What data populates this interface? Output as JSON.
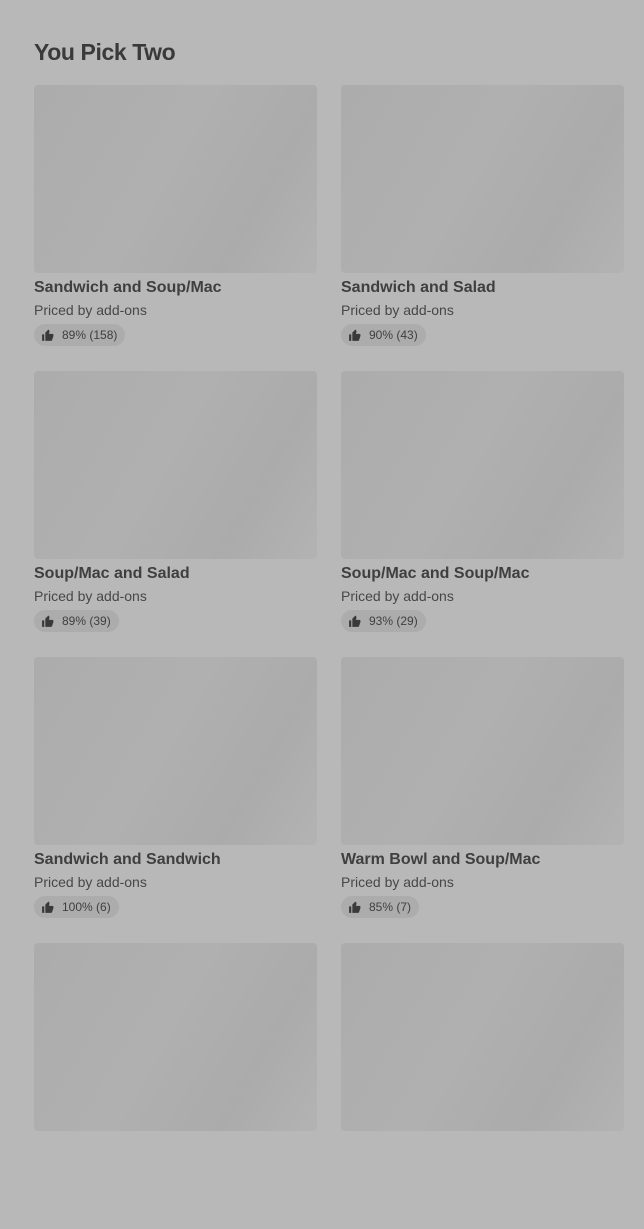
{
  "section": {
    "title": "You Pick Two"
  },
  "items": [
    {
      "name": "Sandwich and Soup/Mac",
      "price": "Priced by add-ons",
      "rating": "89% (158)"
    },
    {
      "name": "Sandwich and Salad",
      "price": "Priced by add-ons",
      "rating": "90% (43)"
    },
    {
      "name": "Soup/Mac and Salad",
      "price": "Priced by add-ons",
      "rating": "89% (39)"
    },
    {
      "name": "Soup/Mac and Soup/Mac",
      "price": "Priced by add-ons",
      "rating": "93% (29)"
    },
    {
      "name": "Sandwich and Sandwich",
      "price": "Priced by add-ons",
      "rating": "100% (6)"
    },
    {
      "name": "Warm Bowl and Soup/Mac",
      "price": "Priced by add-ons",
      "rating": "85% (7)"
    },
    {
      "name": "",
      "price": "",
      "rating": ""
    },
    {
      "name": "",
      "price": "",
      "rating": ""
    }
  ],
  "icons": {
    "rating": "thumbs-up-icon"
  },
  "colors": {
    "background": "#b8b8b8",
    "image_placeholder": "#aeaeae",
    "badge": "#acacac",
    "text": "#3b3b3b"
  }
}
